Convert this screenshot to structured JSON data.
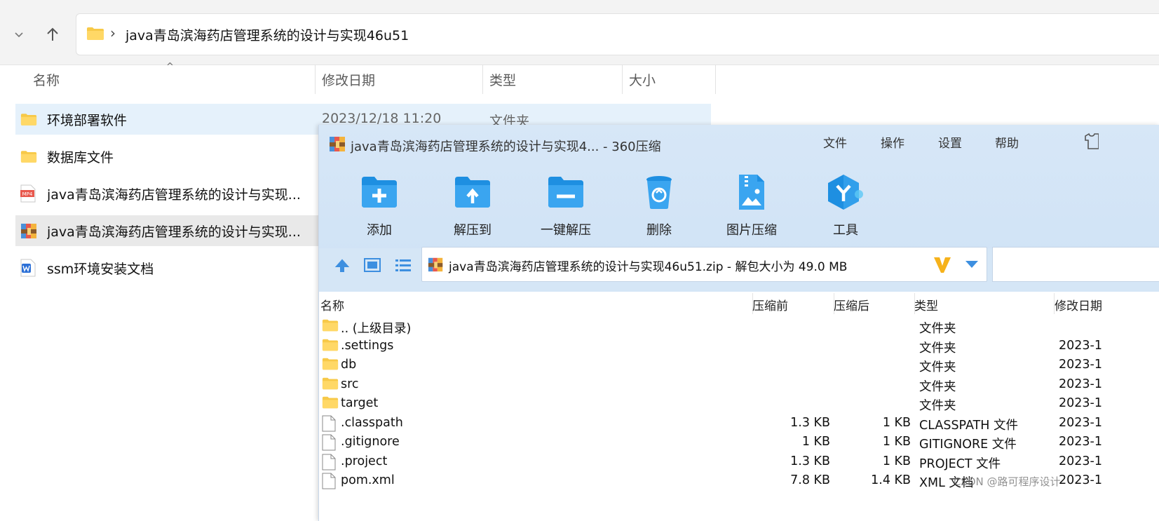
{
  "explorer": {
    "breadcrumb_sep": "›",
    "address": "java青岛滨海药店管理系统的设计与实现46u51",
    "columns": {
      "name": "名称",
      "modified": "修改日期",
      "type": "类型",
      "size": "大小"
    },
    "items": [
      {
        "name": "环境部署软件",
        "icon": "folder-icon",
        "modified": "2023/12/18 11:20",
        "type": "文件夹"
      },
      {
        "name": "数据库文件",
        "icon": "folder-icon"
      },
      {
        "name": "java青岛滨海药店管理系统的设计与实现...",
        "icon": "mp4-file-icon"
      },
      {
        "name": "java青岛滨海药店管理系统的设计与实现...",
        "icon": "zip-archive-icon"
      },
      {
        "name": "ssm环境安装文档",
        "icon": "word-doc-icon"
      }
    ],
    "mp4_badge": "MP4"
  },
  "zip": {
    "title": "java青岛滨海药店管理系统的设计与实现4... - 360压缩",
    "menu": [
      "文件",
      "操作",
      "设置",
      "帮助"
    ],
    "tools": [
      {
        "label": "添加",
        "icon": "add-icon"
      },
      {
        "label": "解压到",
        "icon": "extract-to-icon"
      },
      {
        "label": "一键解压",
        "icon": "one-click-extract-icon"
      },
      {
        "label": "删除",
        "icon": "delete-icon"
      },
      {
        "label": "图片压缩",
        "icon": "image-compress-icon"
      },
      {
        "label": "工具",
        "icon": "tools-icon"
      }
    ],
    "path": "java青岛滨海药店管理系统的设计与实现46u51.zip - 解包大小为 49.0 MB",
    "columns": {
      "name": "名称",
      "before": "压缩前",
      "after": "压缩后",
      "type": "类型",
      "modified": "修改日期"
    },
    "rows": [
      {
        "name": ".. (上级目录)",
        "icon": "folder-icon",
        "before": "",
        "after": "",
        "type": "文件夹",
        "modified": ""
      },
      {
        "name": ".settings",
        "icon": "folder-icon",
        "before": "",
        "after": "",
        "type": "文件夹",
        "modified": "2023-1"
      },
      {
        "name": "db",
        "icon": "folder-icon",
        "before": "",
        "after": "",
        "type": "文件夹",
        "modified": "2023-1"
      },
      {
        "name": "src",
        "icon": "folder-icon",
        "before": "",
        "after": "",
        "type": "文件夹",
        "modified": "2023-1"
      },
      {
        "name": "target",
        "icon": "folder-icon",
        "before": "",
        "after": "",
        "type": "文件夹",
        "modified": "2023-1"
      },
      {
        "name": ".classpath",
        "icon": "file-icon",
        "before": "1.3 KB",
        "after": "1 KB",
        "type": "CLASSPATH 文件",
        "modified": "2023-1"
      },
      {
        "name": ".gitignore",
        "icon": "file-icon",
        "before": "1 KB",
        "after": "1 KB",
        "type": "GITIGNORE 文件",
        "modified": "2023-1"
      },
      {
        "name": ".project",
        "icon": "file-icon",
        "before": "1.3 KB",
        "after": "1 KB",
        "type": "PROJECT 文件",
        "modified": "2023-1"
      },
      {
        "name": "pom.xml",
        "icon": "file-icon",
        "before": "7.8 KB",
        "after": "1.4 KB",
        "type": "XML 文档",
        "modified": "2023-1"
      }
    ]
  },
  "watermark": "CSDN @路可程序设计",
  "colors": {
    "folder": "#f7c948",
    "zip_blue": "#1e8fe1",
    "selection": "#e5f1fb",
    "zip_bg": "#d7e7f7"
  }
}
